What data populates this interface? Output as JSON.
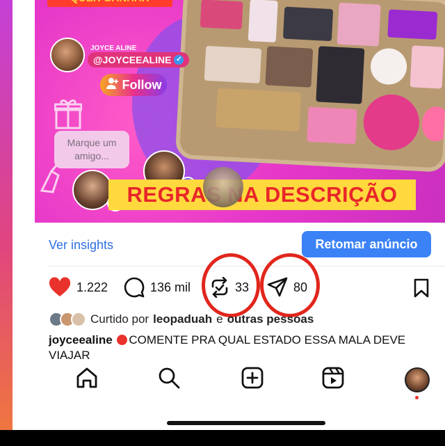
{
  "post": {
    "banner_top": "QUER GANHAR",
    "profile": {
      "name": "JOYCE ALINE",
      "handle": "@JOYCEEALINE"
    },
    "follow_label": "Follow",
    "mention_prompt": "Marque um amigo...",
    "rules_banner": "REGRAS NA DESCRIÇÃO"
  },
  "insights": {
    "link_label": "Ver insights",
    "resume_label": "Retomar anúncio"
  },
  "actions": {
    "likes": "1.222",
    "comments": "136 mil",
    "reposts": "33",
    "shares": "80"
  },
  "liked_by": {
    "prefix": "Curtido por",
    "user": "leopaduah",
    "connector": "e",
    "others": "outras pessoas"
  },
  "caption": {
    "username": "joyceealine",
    "text": "COMENTE PRA QUAL ESTADO ESSA MALA DEVE VIAJAR"
  },
  "colors": {
    "accent_blue": "#3b82f6",
    "link_blue": "#2f6fe0",
    "like_red": "#e8322b",
    "annotation_red": "#e1261c"
  },
  "icons": [
    "heart-icon",
    "comment-icon",
    "repost-icon",
    "share-icon",
    "bookmark-icon",
    "home-icon",
    "search-icon",
    "create-icon",
    "reels-icon"
  ]
}
